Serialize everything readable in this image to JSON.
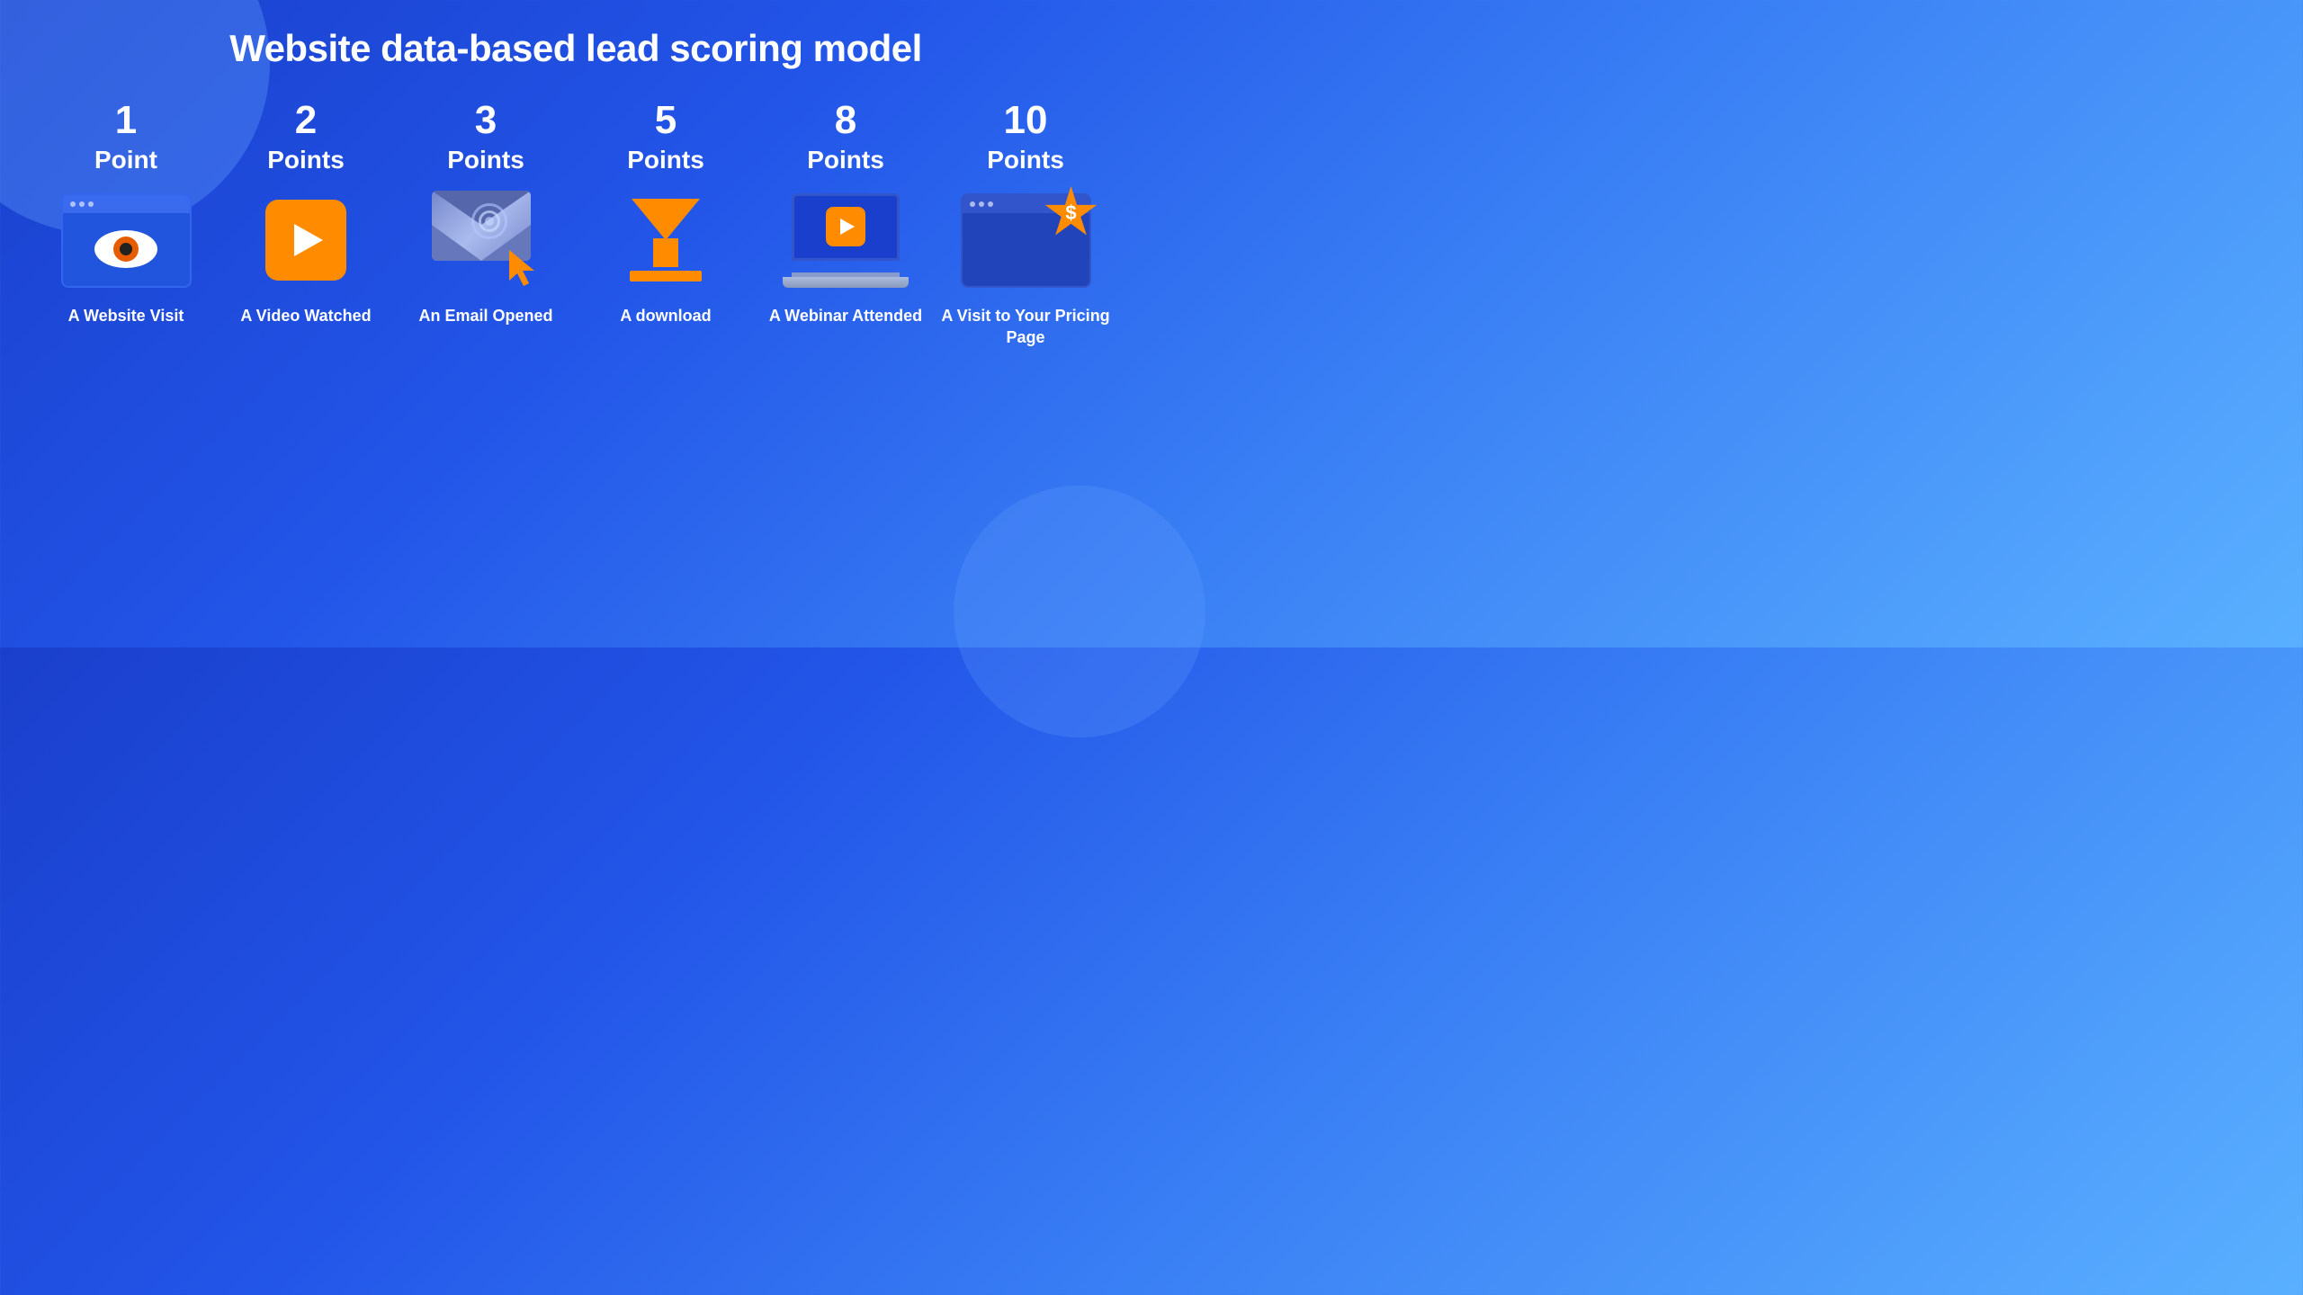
{
  "page": {
    "title": "Website data-based lead scoring model",
    "background_gradient_start": "#1a40d0",
    "background_gradient_end": "#5ab0ff"
  },
  "items": [
    {
      "id": "website-visit",
      "points_number": "1",
      "points_label": "Point",
      "description": "A Website Visit",
      "icon": "browser-eye-icon"
    },
    {
      "id": "video-watched",
      "points_number": "2",
      "points_label": "Points",
      "description": "A Video Watched",
      "icon": "play-button-icon"
    },
    {
      "id": "email-opened",
      "points_number": "3",
      "points_label": "Points",
      "description": "An Email Opened",
      "icon": "envelope-cursor-icon"
    },
    {
      "id": "download",
      "points_number": "5",
      "points_label": "Points",
      "description": "A download",
      "icon": "download-arrow-icon"
    },
    {
      "id": "webinar-attended",
      "points_number": "8",
      "points_label": "Points",
      "description": "A Webinar Attended",
      "icon": "laptop-play-icon"
    },
    {
      "id": "pricing-page",
      "points_number": "10",
      "points_label": "Points",
      "description": "A Visit to Your Pricing Page",
      "icon": "browser-dollar-icon"
    }
  ]
}
